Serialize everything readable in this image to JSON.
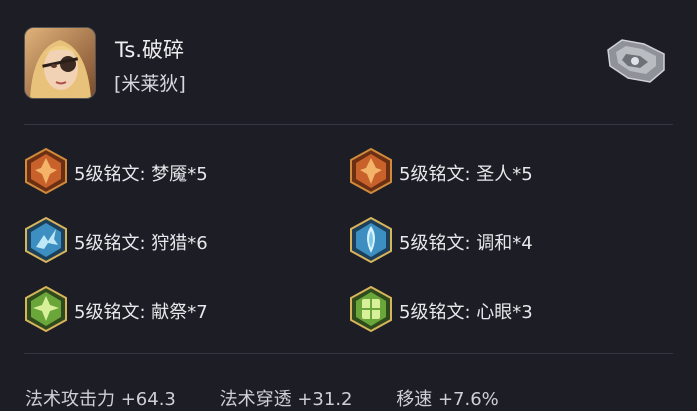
{
  "player": {
    "name": "Ts.破碎",
    "hero": "[米莱狄]"
  },
  "runes": [
    {
      "label": "5级铭文: 梦魇*5",
      "icon": "red-rune-icon",
      "color": "#c8612a"
    },
    {
      "label": "5级铭文: 圣人*5",
      "icon": "red-rune-icon",
      "color": "#c8612a"
    },
    {
      "label": "5级铭文: 狩猎*6",
      "icon": "blue-rune-icon",
      "color": "#3c8fc0"
    },
    {
      "label": "5级铭文: 调和*4",
      "icon": "blue-rune-icon",
      "color": "#3c8fc0"
    },
    {
      "label": "5级铭文: 献祭*7",
      "icon": "green-rune-icon",
      "color": "#6aa63a"
    },
    {
      "label": "5级铭文: 心眼*3",
      "icon": "green-rune-icon",
      "color": "#6aa63a"
    }
  ],
  "stats": {
    "magic_attack": "法术攻击力 +64.3",
    "magic_pierce": "法术穿透 +31.2",
    "move_speed": "移速 +7.6%"
  }
}
